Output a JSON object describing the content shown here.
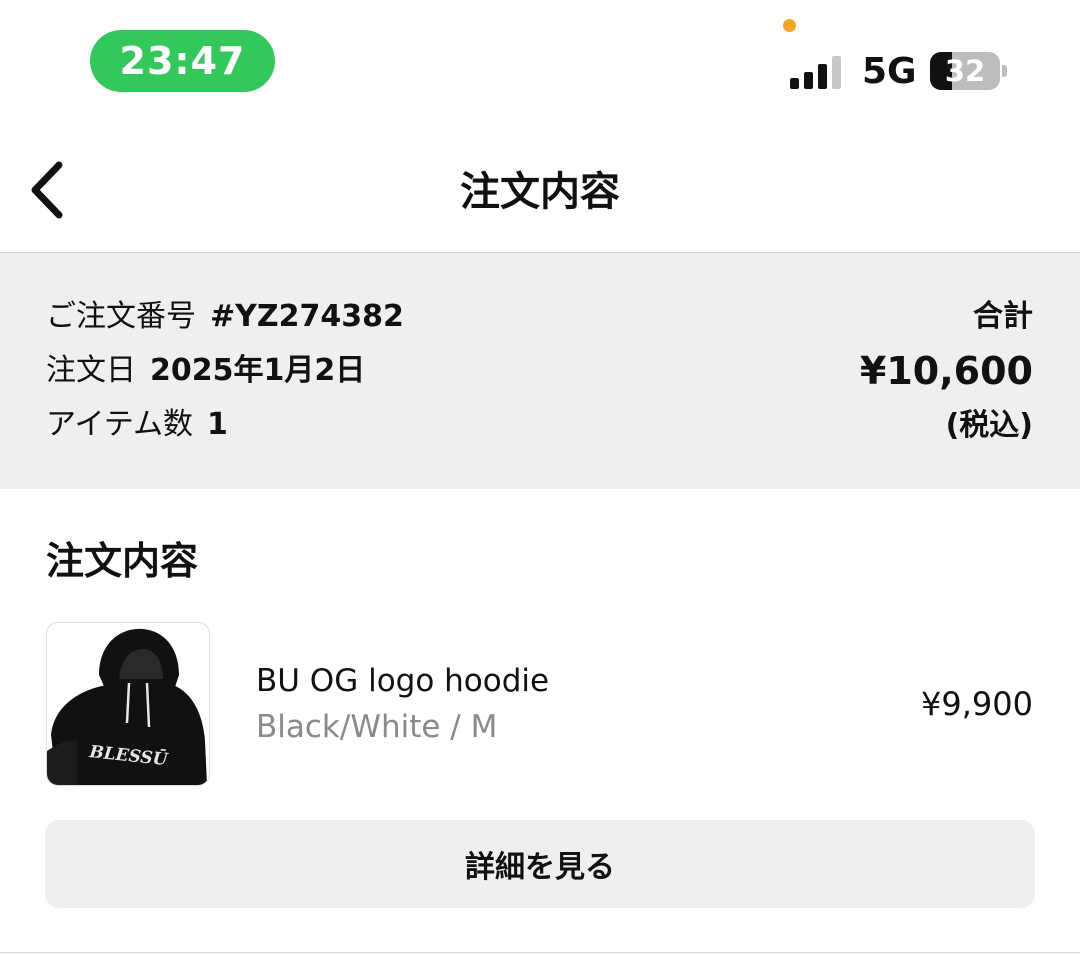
{
  "status_bar": {
    "time": "23:47",
    "network": "5G",
    "battery_level": "32",
    "battery_fraction": 0.32,
    "signal_bars_active": 3,
    "signal_bars_total": 4,
    "time_pill_color": "#33c85a",
    "privacy_dot_color": "#f5a623"
  },
  "nav": {
    "title": "注文内容",
    "back_icon": "chevron-left-icon"
  },
  "summary": {
    "order_number_label": "ご注文番号",
    "order_number": "#YZ274382",
    "order_date_label": "注文日",
    "order_date": "2025年1月2日",
    "item_count_label": "アイテム数",
    "item_count": "1",
    "total_label": "合計",
    "total_amount": "¥10,600",
    "tax_note": "(税込)"
  },
  "contents": {
    "section_title": "注文内容",
    "items": [
      {
        "name": "BU OG logo hoodie",
        "variant": "Black/White / M",
        "price": "¥9,900",
        "thumb_logo": "BLESSŪ"
      }
    ],
    "details_button": "詳細を見る"
  }
}
